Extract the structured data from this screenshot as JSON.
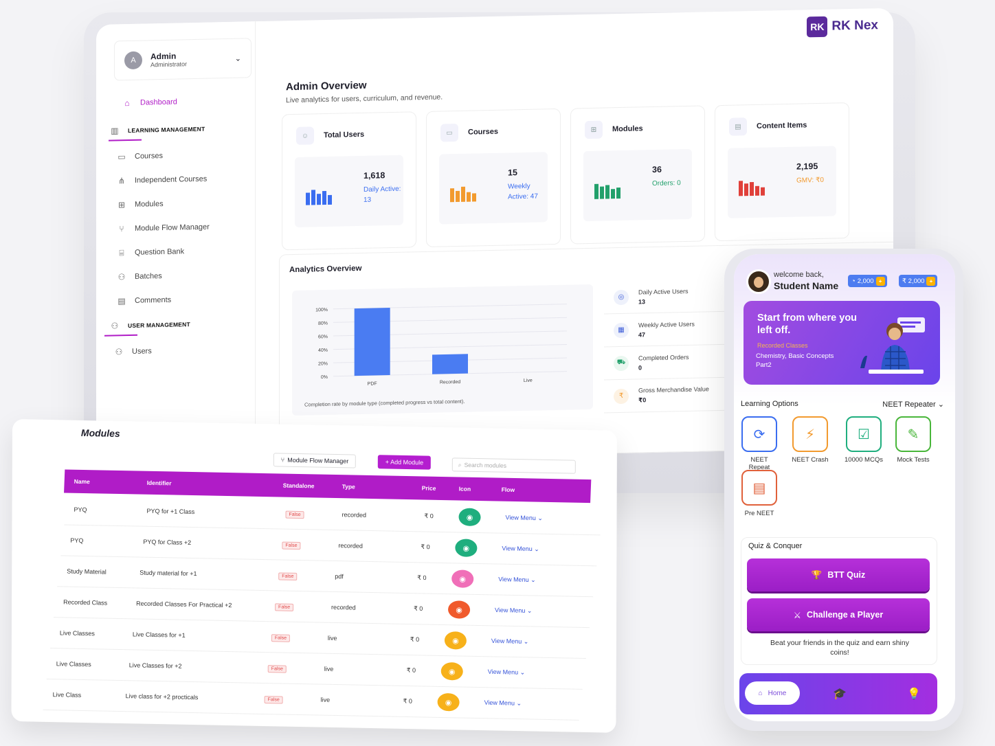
{
  "admin": {
    "initial": "A",
    "name": "Admin",
    "role": "Administrator"
  },
  "brand": {
    "logo_mark": "RK",
    "logo_text": "RK Nex"
  },
  "sidebar": {
    "dashboard": "Dashboard",
    "learning_section": "LEARNING MANAGEMENT",
    "items": [
      "Courses",
      "Independent Courses",
      "Modules",
      "Module Flow Manager",
      "Question Bank",
      "Batches",
      "Comments"
    ],
    "user_section": "USER MANAGEMENT",
    "users": "Users"
  },
  "overview": {
    "title": "Admin Overview",
    "subtitle": "Live analytics for users, curriculum, and revenue."
  },
  "stats": [
    {
      "label": "Total Users",
      "value": "1,618",
      "sub": "Daily Active: 13",
      "color": "#3a6df0",
      "sub_color": "#3a6df0"
    },
    {
      "label": "Courses",
      "value": "15",
      "sub": "Weekly Active: 47",
      "color": "#f29a2e",
      "sub_color": "#3a6df0"
    },
    {
      "label": "Modules",
      "value": "36",
      "sub": "Orders: 0",
      "color": "#22a06b",
      "sub_color": "#22a06b"
    },
    {
      "label": "Content Items",
      "value": "2,195",
      "sub": "GMV: ₹0",
      "color": "#e0403a",
      "sub_color": "#f29a2e"
    }
  ],
  "analytics": {
    "title": "Analytics Overview",
    "caption": "Completion rate by module type (completed progress vs total content).",
    "metrics": [
      {
        "label": "Daily Active Users",
        "value": "13",
        "icon": "target-icon"
      },
      {
        "label": "Weekly Active Users",
        "value": "47",
        "icon": "calendar-icon"
      },
      {
        "label": "Completed Orders",
        "value": "0",
        "icon": "cart-icon"
      },
      {
        "label": "Gross Merchandise Value",
        "value": "₹0",
        "icon": "rupee-icon"
      }
    ]
  },
  "chart_data": {
    "type": "bar",
    "categories": [
      "PDF",
      "Recorded",
      "Live"
    ],
    "values": [
      100,
      29,
      0
    ],
    "yticks": [
      "0%",
      "20%",
      "40%",
      "60%",
      "80%",
      "100%"
    ],
    "ylim": [
      0,
      100
    ],
    "color": "#4a7cf2"
  },
  "modules": {
    "title": "Modules",
    "flow_btn": "Module Flow Manager",
    "add_btn": "+ Add Module",
    "search_placeholder": "Search modules",
    "columns": [
      "Name",
      "Identifier",
      "Standalone",
      "Type",
      "Price",
      "Icon",
      "Flow"
    ],
    "rows": [
      {
        "name": "PYQ",
        "identifier": "PYQ for +1 Class",
        "standalone": "False",
        "type": "recorded",
        "price": "₹ 0",
        "icon_color": "#1fae7e",
        "flow": "View Menu"
      },
      {
        "name": "PYQ",
        "identifier": "PYQ for Class +2",
        "standalone": "False",
        "type": "recorded",
        "price": "₹ 0",
        "icon_color": "#1fae7e",
        "flow": "View Menu"
      },
      {
        "name": "Study Material",
        "identifier": "Study material for +1",
        "standalone": "False",
        "type": "pdf",
        "price": "₹ 0",
        "icon_color": "#f06fb8",
        "flow": "View Menu"
      },
      {
        "name": "Recorded Class",
        "identifier": "Recorded Classes For Practical +2",
        "standalone": "False",
        "type": "recorded",
        "price": "₹ 0",
        "icon_color": "#f05a2c",
        "flow": "View Menu"
      },
      {
        "name": "Live Classes",
        "identifier": "Live Classes for +1",
        "standalone": "False",
        "type": "live",
        "price": "₹ 0",
        "icon_color": "#f7b11a",
        "flow": "View Menu"
      },
      {
        "name": "Live Classes",
        "identifier": "Live Classes for +2",
        "standalone": "False",
        "type": "live",
        "price": "₹ 0",
        "icon_color": "#f7b11a",
        "flow": "View Menu"
      },
      {
        "name": "Live Class",
        "identifier": "Live class for +2 procticals",
        "standalone": "False",
        "type": "live",
        "price": "₹ 0",
        "icon_color": "#f7b11a",
        "flow": "View Menu"
      }
    ]
  },
  "phone": {
    "welcome": "welcome back,",
    "student": "Student Name",
    "coins": [
      "2,000",
      "₹ 2,000"
    ],
    "banner": {
      "heading": "Start from where you left off.",
      "tag": "Recorded Classes",
      "desc": "Chemistry, Basic Concepts Part2"
    },
    "learning_title": "Learning Options",
    "learning_select": "NEET Repeater",
    "options": [
      {
        "label": "NEET Repeat",
        "color": "#3a6df0",
        "glyph": "⟳"
      },
      {
        "label": "NEET Crash",
        "color": "#f29a2e",
        "glyph": "⚡"
      },
      {
        "label": "10000 MCQs",
        "color": "#1fae7e",
        "glyph": "☑"
      },
      {
        "label": "Mock Tests",
        "color": "#49b63a",
        "glyph": "✎"
      },
      {
        "label": "Pre NEET",
        "color": "#e0603a",
        "glyph": "▤"
      }
    ],
    "quiz_title": "Quiz & Conquer",
    "btt": "BTT Quiz",
    "challenge": "Challenge a Player",
    "quiz_foot": "Beat your friends in the quiz and earn shiny coins!",
    "home": "Home"
  }
}
